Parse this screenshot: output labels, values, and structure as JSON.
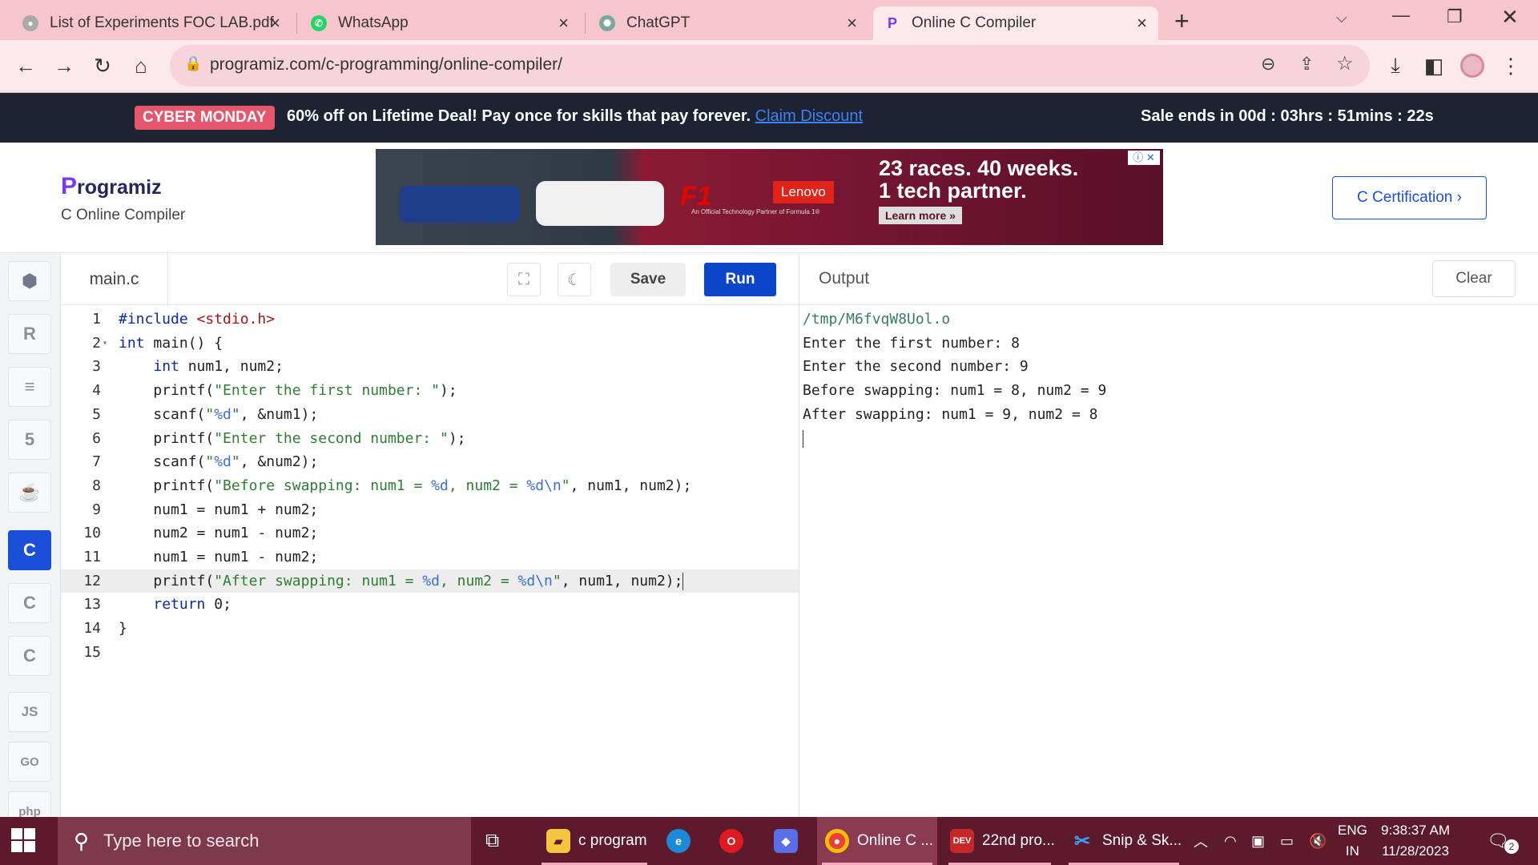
{
  "browser": {
    "tabs": [
      {
        "title": "List of Experiments FOC LAB.pdf",
        "icon": "pdf-icon"
      },
      {
        "title": "WhatsApp",
        "icon": "whatsapp-icon"
      },
      {
        "title": "ChatGPT",
        "icon": "chatgpt-icon"
      },
      {
        "title": "Online C Compiler",
        "icon": "programiz-icon",
        "active": true
      }
    ],
    "new_tab": "+",
    "url": "programiz.com/c-programming/online-compiler/"
  },
  "promo": {
    "badge": "CYBER MONDAY",
    "text": "60% off on Lifetime Deal! Pay once for skills that pay forever.",
    "link": "Claim Discount",
    "countdown": "Sale ends in 00d : 03hrs : 51mins : 22s"
  },
  "header": {
    "logo": "rogramiz",
    "logo_mark": "P",
    "subtitle": "C Online Compiler",
    "certification_button": "C Certification ›"
  },
  "ad": {
    "headline_1": "23 races. 40 weeks.",
    "headline_2": "1 tech partner.",
    "brand": "Lenovo",
    "cta": "Learn more »",
    "partner_line": "An Official Technology Partner of Formula 1®",
    "f1": "F1"
  },
  "languages": [
    {
      "name": "python-icon",
      "glyph": "🐍"
    },
    {
      "name": "r-icon",
      "glyph": "R"
    },
    {
      "name": "sql-icon",
      "glyph": "≡"
    },
    {
      "name": "html-icon",
      "glyph": "5"
    },
    {
      "name": "java-icon",
      "glyph": "☕"
    },
    {
      "name": "c-icon",
      "glyph": "C",
      "active": true
    },
    {
      "name": "cpp-icon",
      "glyph": "C"
    },
    {
      "name": "csharp-icon",
      "glyph": "C"
    },
    {
      "name": "js-icon",
      "glyph": "JS"
    },
    {
      "name": "go-icon",
      "glyph": "GO"
    },
    {
      "name": "php-icon",
      "glyph": "php"
    }
  ],
  "editor": {
    "filename": "main.c",
    "save_label": "Save",
    "run_label": "Run",
    "current_line": 12,
    "lines": [
      "#include <stdio.h>",
      "int main() {",
      "    int num1, num2;",
      "    printf(\"Enter the first number: \");",
      "    scanf(\"%d\", &num1);",
      "    printf(\"Enter the second number: \");",
      "    scanf(\"%d\", &num2);",
      "    printf(\"Before swapping: num1 = %d, num2 = %d\\n\", num1, num2);",
      "    num1 = num1 + num2;",
      "    num2 = num1 - num2;",
      "    num1 = num1 - num2;",
      "    printf(\"After swapping: num1 = %d, num2 = %d\\n\", num1, num2);",
      "    return 0;",
      "}",
      ""
    ]
  },
  "output": {
    "title": "Output",
    "clear_label": "Clear",
    "path": "/tmp/M6fvqW8Uol.o",
    "lines": [
      "Enter the first number: 8",
      "Enter the second number: 9",
      "Before swapping: num1 = 8, num2 = 9",
      "After swapping: num1 = 9, num2 = 8"
    ]
  },
  "taskbar": {
    "search_placeholder": "Type here to search",
    "apps": [
      {
        "label": "c program",
        "icon": "folder-icon"
      },
      {
        "label": "",
        "icon": "edge-icon"
      },
      {
        "label": "",
        "icon": "opera-icon"
      },
      {
        "label": "",
        "icon": "copilot-icon"
      },
      {
        "label": "Online C ...",
        "icon": "chrome-icon",
        "active": true
      },
      {
        "label": "22nd pro...",
        "icon": "devcpp-icon"
      },
      {
        "label": "Snip & Sk...",
        "icon": "snip-icon"
      }
    ],
    "language": "ENG",
    "region": "IN",
    "time": "9:38:37 AM",
    "date": "11/28/2023",
    "notifications": "2"
  },
  "colors": {
    "accent": "#0b45c9",
    "tab_bar": "#f6c5ce",
    "promo_bg": "#1d2333",
    "taskbar": "#5c1a2c"
  }
}
